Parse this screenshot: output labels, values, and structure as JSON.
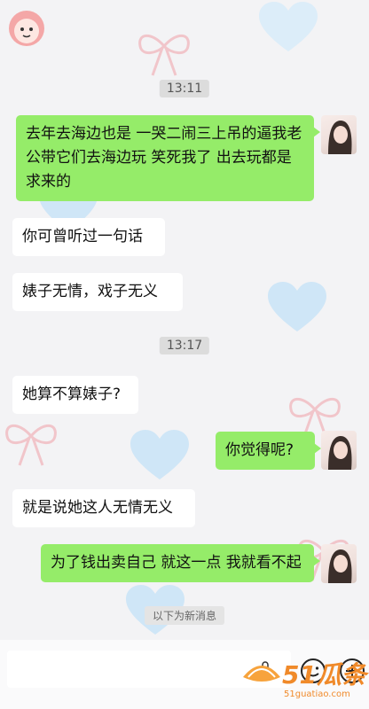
{
  "colors": {
    "sent_bubble": "#95ec69",
    "recv_bubble": "#ffffff",
    "watermark": "#f08a2a"
  },
  "timestamps": [
    "13:11",
    "13:17"
  ],
  "messages": [
    {
      "side": "sent",
      "text": "去年去海边也是 一哭二闹三上吊的逼我老公带它们去海边玩 笑死我了 出去玩都是求来的"
    },
    {
      "side": "recv",
      "text": "你可曾听过一句话"
    },
    {
      "side": "recv",
      "text": "婊子无情，戏子无义"
    },
    {
      "side": "recv",
      "text": "她算不算婊子?"
    },
    {
      "side": "sent",
      "text": "你觉得呢?"
    },
    {
      "side": "recv",
      "text": "就是说她这人无情无义"
    },
    {
      "side": "sent",
      "text": "为了钱出卖自己 就这一点 我就看不起"
    }
  ],
  "new_messages_label": "以下为新消息",
  "input_bar": {
    "icons": [
      "voice-icon",
      "emoji-icon",
      "plus-icon"
    ]
  },
  "watermark": {
    "brand": "51瓜条",
    "domain": "51guatiao.com"
  }
}
